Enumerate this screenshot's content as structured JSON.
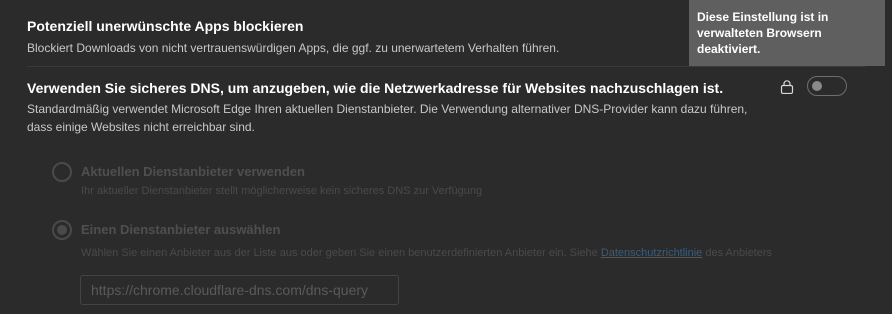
{
  "pua": {
    "title": "Potenziell unerwünschte Apps blockieren",
    "description": "Blockiert Downloads von nicht vertrauenswürdigen Apps, die ggf. zu unerwartetem Verhalten führen."
  },
  "tooltip": {
    "text": "Diese Einstellung ist in verwalteten Browsern deaktiviert."
  },
  "dns": {
    "title": "Verwenden Sie sicheres DNS, um anzugeben, wie die Netzwerkadresse für Websites nachzuschlagen ist.",
    "description_line1": "Standardmäßig verwendet Microsoft Edge Ihren aktuellen Dienstanbieter. Die Verwendung alternativer DNS-Provider kann dazu führen,",
    "description_line2": "dass einige Websites nicht erreichbar sind.",
    "enabled": false,
    "lock_icon": "lock-icon"
  },
  "options": {
    "current": {
      "title": "Aktuellen Dienstanbieter verwenden",
      "description": "Ihr aktueller Dienstanbieter stellt möglicherweise kein sicheres DNS zur Verfügung"
    },
    "choose": {
      "title": "Einen Dienstanbieter auswählen",
      "description_before": "Wählen Sie einen Anbieter aus der Liste aus oder geben Sie einen benutzerdefinierten Anbieter ein. Siehe ",
      "link": "Datenschutzrichtlinie",
      "description_after": " des Anbieters",
      "selected": true,
      "input_value": "https://chrome.cloudflare-dns.com/dns-query"
    }
  },
  "colors": {
    "background": "#2b2b2b",
    "tooltip_bg": "#5f5f5f",
    "disabled_text": "#4f4f4f",
    "link": "#3d5c78"
  }
}
